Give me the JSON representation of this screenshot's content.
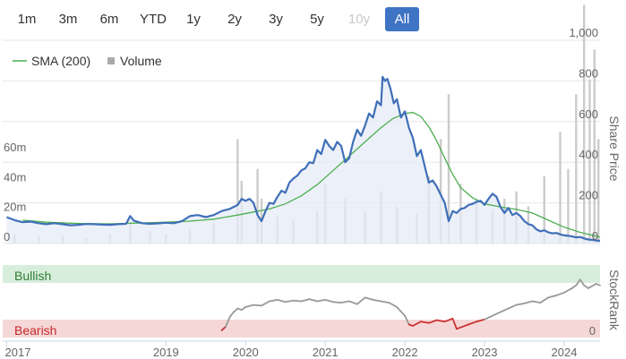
{
  "range_buttons": [
    {
      "label": "1m",
      "state": "normal"
    },
    {
      "label": "3m",
      "state": "normal"
    },
    {
      "label": "6m",
      "state": "normal"
    },
    {
      "label": "YTD",
      "state": "normal"
    },
    {
      "label": "1y",
      "state": "normal"
    },
    {
      "label": "2y",
      "state": "normal"
    },
    {
      "label": "3y",
      "state": "normal"
    },
    {
      "label": "5y",
      "state": "normal"
    },
    {
      "label": "10y",
      "state": "disabled"
    },
    {
      "label": "All",
      "state": "active"
    }
  ],
  "colors": {
    "price": "#3f6fb8",
    "sma": "#4caf50",
    "volume": "#cccccc",
    "rank": "#999999",
    "rank_bearish": "#cc3333",
    "bullish_band": "#d8eedc",
    "bearish_band": "#f6d7d7",
    "bullish_text": "#2e7d32",
    "bearish_text": "#c62828",
    "active_button": "#3f74c4"
  },
  "chart_data": {
    "type": "line",
    "legend": [
      {
        "name": "SMA (200)",
        "symbol": "line"
      },
      {
        "name": "Volume",
        "symbol": "square"
      }
    ],
    "legend_position": "top-left",
    "right_axis_label": "Share Price",
    "price_axis": {
      "ticks": [
        "0",
        "200",
        "400",
        "600",
        "800",
        "1,000"
      ],
      "ylim": [
        0,
        1000
      ]
    },
    "volume_axis": {
      "ticks": [
        "0",
        "20m",
        "40m",
        "60m"
      ],
      "ylim": [
        0,
        180
      ]
    },
    "x_ticks": [
      "2017",
      "2019",
      "2020",
      "2021",
      "2022",
      "2023",
      "2024"
    ],
    "x_range": [
      2016.95,
      2024.45
    ],
    "price": [
      [
        2017.0,
        130
      ],
      [
        2017.1,
        115
      ],
      [
        2017.2,
        105
      ],
      [
        2017.3,
        108
      ],
      [
        2017.4,
        100
      ],
      [
        2017.5,
        95
      ],
      [
        2017.6,
        100
      ],
      [
        2017.7,
        95
      ],
      [
        2017.8,
        90
      ],
      [
        2017.9,
        92
      ],
      [
        2018.0,
        96
      ],
      [
        2018.1,
        95
      ],
      [
        2018.2,
        93
      ],
      [
        2018.3,
        92
      ],
      [
        2018.4,
        95
      ],
      [
        2018.5,
        97
      ],
      [
        2018.55,
        135
      ],
      [
        2018.6,
        112
      ],
      [
        2018.7,
        100
      ],
      [
        2018.8,
        97
      ],
      [
        2018.9,
        99
      ],
      [
        2019.0,
        102
      ],
      [
        2019.1,
        100
      ],
      [
        2019.2,
        110
      ],
      [
        2019.3,
        135
      ],
      [
        2019.4,
        140
      ],
      [
        2019.5,
        130
      ],
      [
        2019.6,
        140
      ],
      [
        2019.7,
        160
      ],
      [
        2019.8,
        170
      ],
      [
        2019.9,
        190
      ],
      [
        2019.95,
        220
      ],
      [
        2020.0,
        210
      ],
      [
        2020.05,
        220
      ],
      [
        2020.1,
        200
      ],
      [
        2020.15,
        140
      ],
      [
        2020.2,
        110
      ],
      [
        2020.25,
        160
      ],
      [
        2020.3,
        200
      ],
      [
        2020.35,
        195
      ],
      [
        2020.4,
        230
      ],
      [
        2020.45,
        260
      ],
      [
        2020.5,
        250
      ],
      [
        2020.55,
        300
      ],
      [
        2020.6,
        320
      ],
      [
        2020.65,
        335
      ],
      [
        2020.7,
        360
      ],
      [
        2020.75,
        370
      ],
      [
        2020.8,
        400
      ],
      [
        2020.85,
        395
      ],
      [
        2020.9,
        460
      ],
      [
        2020.95,
        440
      ],
      [
        2021.0,
        510
      ],
      [
        2021.05,
        480
      ],
      [
        2021.1,
        460
      ],
      [
        2021.15,
        500
      ],
      [
        2021.2,
        480
      ],
      [
        2021.25,
        400
      ],
      [
        2021.3,
        420
      ],
      [
        2021.35,
        500
      ],
      [
        2021.4,
        560
      ],
      [
        2021.45,
        530
      ],
      [
        2021.5,
        580
      ],
      [
        2021.55,
        640
      ],
      [
        2021.6,
        620
      ],
      [
        2021.65,
        700
      ],
      [
        2021.7,
        680
      ],
      [
        2021.72,
        820
      ],
      [
        2021.75,
        800
      ],
      [
        2021.78,
        810
      ],
      [
        2021.82,
        760
      ],
      [
        2021.86,
        690
      ],
      [
        2021.9,
        710
      ],
      [
        2021.95,
        620
      ],
      [
        2022.0,
        650
      ],
      [
        2022.05,
        570
      ],
      [
        2022.1,
        520
      ],
      [
        2022.15,
        430
      ],
      [
        2022.2,
        460
      ],
      [
        2022.25,
        380
      ],
      [
        2022.3,
        300
      ],
      [
        2022.35,
        310
      ],
      [
        2022.4,
        280
      ],
      [
        2022.45,
        240
      ],
      [
        2022.5,
        200
      ],
      [
        2022.55,
        110
      ],
      [
        2022.6,
        160
      ],
      [
        2022.65,
        150
      ],
      [
        2022.7,
        170
      ],
      [
        2022.75,
        175
      ],
      [
        2022.8,
        190
      ],
      [
        2022.85,
        195
      ],
      [
        2022.9,
        205
      ],
      [
        2022.95,
        210
      ],
      [
        2023.0,
        190
      ],
      [
        2023.05,
        220
      ],
      [
        2023.1,
        245
      ],
      [
        2023.15,
        230
      ],
      [
        2023.2,
        180
      ],
      [
        2023.25,
        150
      ],
      [
        2023.3,
        175
      ],
      [
        2023.35,
        140
      ],
      [
        2023.4,
        150
      ],
      [
        2023.45,
        135
      ],
      [
        2023.5,
        110
      ],
      [
        2023.55,
        95
      ],
      [
        2023.6,
        90
      ],
      [
        2023.65,
        70
      ],
      [
        2023.7,
        60
      ],
      [
        2023.75,
        65
      ],
      [
        2023.8,
        55
      ],
      [
        2023.85,
        50
      ],
      [
        2023.9,
        52
      ],
      [
        2023.95,
        45
      ],
      [
        2024.0,
        40
      ],
      [
        2024.05,
        38
      ],
      [
        2024.1,
        35
      ],
      [
        2024.15,
        30
      ],
      [
        2024.2,
        32
      ],
      [
        2024.25,
        25
      ],
      [
        2024.3,
        20
      ],
      [
        2024.35,
        18
      ],
      [
        2024.4,
        15
      ],
      [
        2024.45,
        13
      ]
    ],
    "sma": [
      [
        2017.2,
        115
      ],
      [
        2017.5,
        105
      ],
      [
        2017.8,
        100
      ],
      [
        2018.0,
        98
      ],
      [
        2018.3,
        97
      ],
      [
        2018.5,
        99
      ],
      [
        2018.8,
        102
      ],
      [
        2019.0,
        105
      ],
      [
        2019.3,
        110
      ],
      [
        2019.6,
        120
      ],
      [
        2019.9,
        140
      ],
      [
        2020.1,
        155
      ],
      [
        2020.3,
        170
      ],
      [
        2020.5,
        195
      ],
      [
        2020.7,
        235
      ],
      [
        2020.9,
        290
      ],
      [
        2021.1,
        360
      ],
      [
        2021.3,
        430
      ],
      [
        2021.5,
        500
      ],
      [
        2021.7,
        570
      ],
      [
        2021.85,
        615
      ],
      [
        2022.0,
        640
      ],
      [
        2022.1,
        645
      ],
      [
        2022.2,
        625
      ],
      [
        2022.3,
        575
      ],
      [
        2022.4,
        505
      ],
      [
        2022.5,
        420
      ],
      [
        2022.6,
        340
      ],
      [
        2022.7,
        275
      ],
      [
        2022.85,
        225
      ],
      [
        2023.0,
        195
      ],
      [
        2023.2,
        180
      ],
      [
        2023.4,
        168
      ],
      [
        2023.6,
        150
      ],
      [
        2023.8,
        115
      ],
      [
        2024.0,
        80
      ],
      [
        2024.2,
        55
      ],
      [
        2024.45,
        32
      ]
    ],
    "volume": [
      [
        2017.1,
        6
      ],
      [
        2017.4,
        5
      ],
      [
        2017.7,
        5
      ],
      [
        2018.0,
        4
      ],
      [
        2018.3,
        6
      ],
      [
        2018.55,
        15
      ],
      [
        2018.8,
        8
      ],
      [
        2019.0,
        6
      ],
      [
        2019.3,
        10
      ],
      [
        2019.6,
        14
      ],
      [
        2019.9,
        70
      ],
      [
        2019.95,
        42
      ],
      [
        2020.15,
        50
      ],
      [
        2020.2,
        30
      ],
      [
        2020.4,
        18
      ],
      [
        2020.6,
        16
      ],
      [
        2020.9,
        22
      ],
      [
        2021.0,
        40
      ],
      [
        2021.25,
        30
      ],
      [
        2021.5,
        22
      ],
      [
        2021.7,
        35
      ],
      [
        2021.9,
        25
      ],
      [
        2022.15,
        20
      ],
      [
        2022.3,
        45
      ],
      [
        2022.45,
        70
      ],
      [
        2022.55,
        100
      ],
      [
        2022.7,
        40
      ],
      [
        2022.9,
        30
      ],
      [
        2023.1,
        22
      ],
      [
        2023.25,
        30
      ],
      [
        2023.4,
        35
      ],
      [
        2023.55,
        25
      ],
      [
        2023.75,
        45
      ],
      [
        2023.95,
        75
      ],
      [
        2024.05,
        50
      ],
      [
        2024.15,
        100
      ],
      [
        2024.25,
        160
      ],
      [
        2024.32,
        110
      ],
      [
        2024.38,
        130
      ],
      [
        2024.43,
        70
      ]
    ],
    "stockrank": {
      "labels": [
        "Bullish",
        "Bearish"
      ],
      "axis_label": "StockRank",
      "axis_ticks": [
        "0"
      ],
      "ylim": [
        0,
        100
      ],
      "bands": {
        "bullish": [
          75,
          100
        ],
        "bearish": [
          0,
          25
        ]
      },
      "values": [
        [
          2019.7,
          10
        ],
        [
          2019.75,
          15
        ],
        [
          2019.8,
          28
        ],
        [
          2019.85,
          35
        ],
        [
          2019.9,
          40
        ],
        [
          2019.95,
          38
        ],
        [
          2020.0,
          42
        ],
        [
          2020.1,
          45
        ],
        [
          2020.2,
          44
        ],
        [
          2020.3,
          50
        ],
        [
          2020.4,
          52
        ],
        [
          2020.5,
          49
        ],
        [
          2020.6,
          51
        ],
        [
          2020.7,
          50
        ],
        [
          2020.8,
          53
        ],
        [
          2020.9,
          50
        ],
        [
          2021.0,
          52
        ],
        [
          2021.1,
          49
        ],
        [
          2021.2,
          48
        ],
        [
          2021.3,
          50
        ],
        [
          2021.4,
          46
        ],
        [
          2021.5,
          55
        ],
        [
          2021.6,
          52
        ],
        [
          2021.7,
          50
        ],
        [
          2021.8,
          48
        ],
        [
          2021.9,
          42
        ],
        [
          2022.0,
          30
        ],
        [
          2022.05,
          18
        ],
        [
          2022.1,
          16
        ],
        [
          2022.2,
          22
        ],
        [
          2022.3,
          20
        ],
        [
          2022.4,
          24
        ],
        [
          2022.5,
          22
        ],
        [
          2022.6,
          26
        ],
        [
          2022.65,
          12
        ],
        [
          2022.7,
          14
        ],
        [
          2022.8,
          18
        ],
        [
          2022.9,
          22
        ],
        [
          2023.0,
          25
        ],
        [
          2023.1,
          30
        ],
        [
          2023.2,
          35
        ],
        [
          2023.3,
          40
        ],
        [
          2023.4,
          45
        ],
        [
          2023.5,
          47
        ],
        [
          2023.6,
          50
        ],
        [
          2023.7,
          48
        ],
        [
          2023.8,
          55
        ],
        [
          2023.9,
          58
        ],
        [
          2024.0,
          62
        ],
        [
          2024.1,
          68
        ],
        [
          2024.15,
          72
        ],
        [
          2024.2,
          80
        ],
        [
          2024.25,
          72
        ],
        [
          2024.3,
          68
        ],
        [
          2024.4,
          74
        ],
        [
          2024.45,
          72
        ]
      ]
    }
  }
}
